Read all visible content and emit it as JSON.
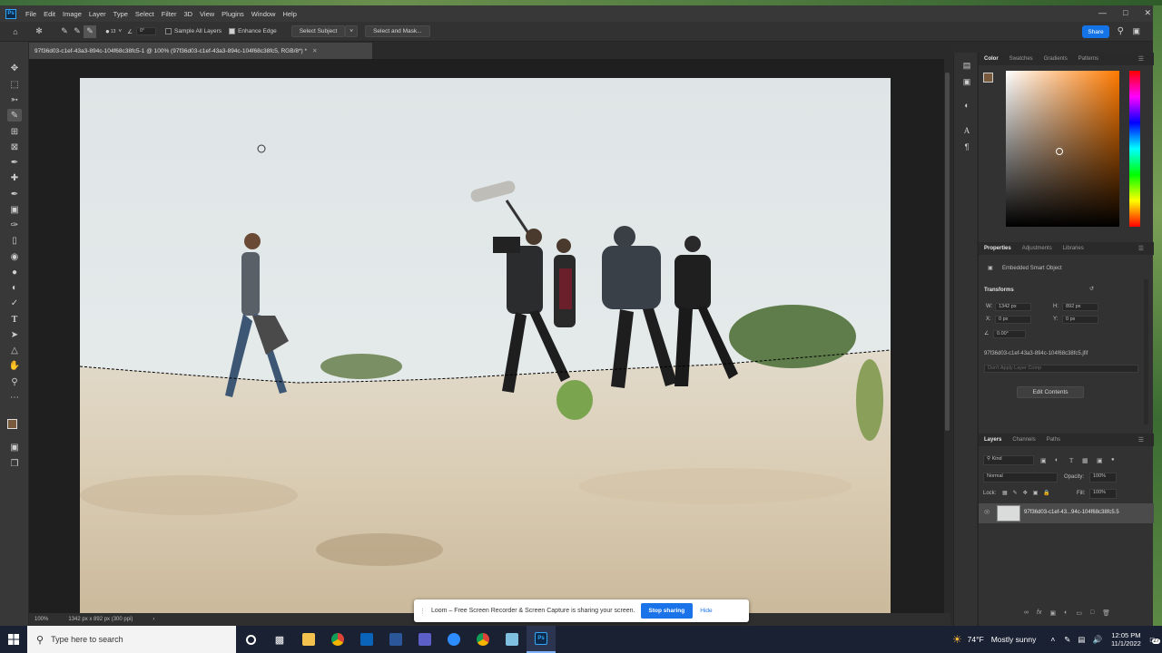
{
  "menu": [
    "File",
    "Edit",
    "Image",
    "Layer",
    "Type",
    "Select",
    "Filter",
    "3D",
    "View",
    "Plugins",
    "Window",
    "Help"
  ],
  "options": {
    "brush_size": "13",
    "angle": "0°",
    "sample_all_layers": "Sample All Layers",
    "enhance_edge": "Enhance Edge",
    "select_subject": "Select Subject",
    "select_and_mask": "Select and Mask...",
    "share": "Share"
  },
  "document": {
    "tab_title": "97f36d03-c1ef-43a3-894c-104f68c38fc5-1 @ 100% (97f36d03-c1ef-43a3-894c-104f68c38fc5, RGB/8*) *",
    "zoom": "100%",
    "size_info": "1342 px x 892 px (300 ppi)"
  },
  "color_panel": {
    "tabs": [
      "Color",
      "Swatches",
      "Gradients",
      "Patterns"
    ],
    "foreground": "#7a5a3c",
    "background": "#efefb4",
    "hue": "#ff7a00"
  },
  "properties": {
    "tabs": [
      "Properties",
      "Adjustments",
      "Libraries"
    ],
    "object_type": "Embedded Smart Object",
    "transform_label": "Transforms",
    "w_label": "W:",
    "w": "1342 px",
    "h_label": "H:",
    "h": "892 px",
    "x_label": "X:",
    "x": "0 px",
    "y_label": "Y:",
    "y": "0 px",
    "angle": "0.00°",
    "filename": "97f36d03-c1ef-43a3-894c-104f68c38fc5.jfif",
    "layer_comp": "Don't Apply Layer Comp",
    "edit_contents": "Edit Contents"
  },
  "layers": {
    "tabs": [
      "Layers",
      "Channels",
      "Paths"
    ],
    "filter": "Kind",
    "blend_mode": "Normal",
    "opacity_label": "Opacity:",
    "opacity": "100%",
    "lock_label": "Lock:",
    "fill_label": "Fill:",
    "fill": "100%",
    "items": [
      {
        "name": "97f36d03-c1ef-43...94c-104f68c38fc5.5"
      }
    ]
  },
  "loom": {
    "message": "Loom – Free Screen Recorder & Screen Capture is sharing your screen.",
    "stop": "Stop sharing",
    "hide": "Hide"
  },
  "taskbar": {
    "search_placeholder": "Type here to search",
    "weather_temp": "74°F",
    "weather_text": "Mostly sunny",
    "time": "12:05 PM",
    "date": "11/1/2022",
    "notifications": "27"
  }
}
